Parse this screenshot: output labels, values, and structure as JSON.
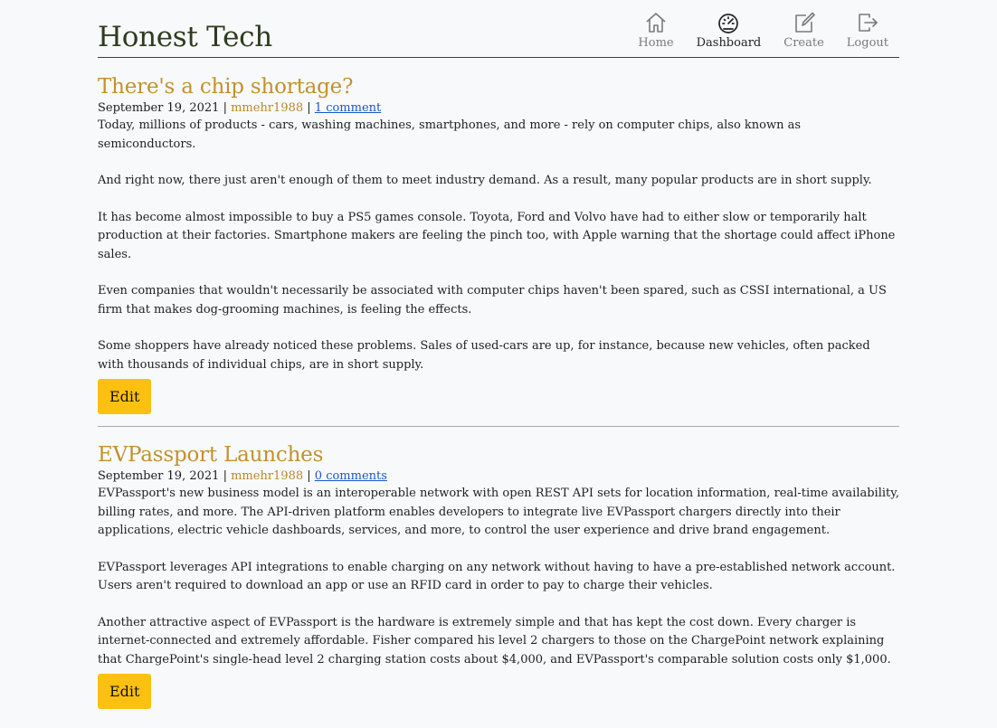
{
  "brand": "Honest Tech",
  "nav": [
    {
      "label": "Home",
      "icon": "home-icon"
    },
    {
      "label": "Dashboard",
      "icon": "dashboard-icon"
    },
    {
      "label": "Create",
      "icon": "create-icon"
    },
    {
      "label": "Logout",
      "icon": "logout-icon"
    }
  ],
  "posts": [
    {
      "title": "There's a chip shortage?",
      "date": "September 19, 2021",
      "author": "mmehr1988",
      "comments": "1 comment",
      "paragraphs": [
        "Today, millions of products - cars, washing machines, smartphones, and more - rely on computer chips, also known as semiconductors.",
        "And right now, there just aren't enough of them to meet industry demand. As a result, many popular products are in short supply.",
        "It has become almost impossible to buy a PS5 games console. Toyota, Ford and Volvo have had to either slow or temporarily halt production at their factories. Smartphone makers are feeling the pinch too, with Apple warning that the shortage could affect iPhone sales.",
        "Even companies that wouldn't necessarily be associated with computer chips haven't been spared, such as CSSI international, a US firm that makes dog-grooming machines, is feeling the effects.",
        "Some shoppers have already noticed these problems. Sales of used-cars are up, for instance, because new vehicles, often packed with thousands of individual chips, are in short supply."
      ],
      "edit_label": "Edit"
    },
    {
      "title": "EVPassport Launches",
      "date": "September 19, 2021",
      "author": "mmehr1988",
      "comments": "0 comments",
      "paragraphs": [
        "EVPassport's new business model is an interoperable network with open REST API sets for location information, real-time availability, billing rates, and more. The API-driven platform enables developers to integrate live EVPassport chargers directly into their applications, electric vehicle dashboards, services, and more, to control the user experience and drive brand engagement.",
        "EVPassport leverages API integrations to enable charging on any network without having to have a pre-established network account. Users aren't required to download an app or use an RFID card in order to pay to charge their vehicles.",
        "Another attractive aspect of EVPassport is the hardware is extremely simple and that has kept the cost down. Every charger is internet-connected and extremely affordable. Fisher compared his level 2 chargers to those on the ChargePoint network explaining that ChargePoint's single-head level 2 charging station costs about $4,000, and EVPassport's comparable solution costs only $1,000."
      ],
      "edit_label": "Edit"
    }
  ],
  "separator": "|"
}
